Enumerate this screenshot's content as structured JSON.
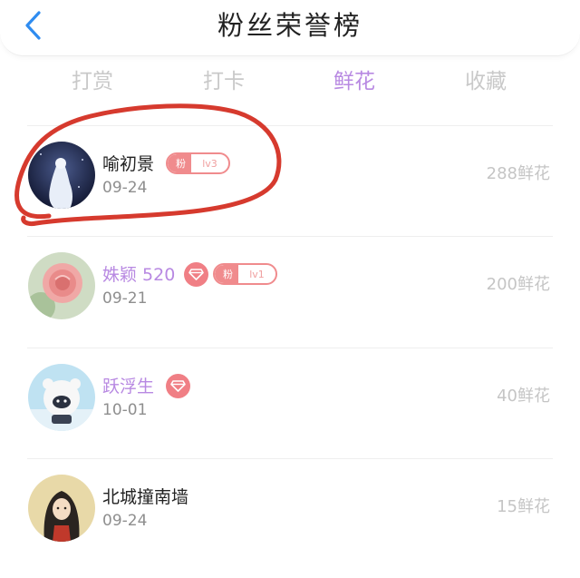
{
  "header": {
    "title": "粉丝荣誉榜"
  },
  "tabs": [
    {
      "label": "打赏",
      "active": false
    },
    {
      "label": "打卡",
      "active": false
    },
    {
      "label": "鲜花",
      "active": true
    },
    {
      "label": "收藏",
      "active": false
    }
  ],
  "fans": [
    {
      "name": "喻初景",
      "date": "09-24",
      "count": "288鲜花",
      "badge_label": "粉",
      "level": "lv3",
      "diamond": false,
      "name_color": "#222222"
    },
    {
      "name": "姝颖 520",
      "date": "09-21",
      "count": "200鲜花",
      "badge_label": "粉",
      "level": "lv1",
      "diamond": true,
      "name_color": "#b889e2"
    },
    {
      "name": "跃浮生",
      "date": "10-01",
      "count": "40鲜花",
      "diamond": true,
      "name_color": "#b889e2"
    },
    {
      "name": "北城撞南墙",
      "date": "09-24",
      "count": "15鲜花",
      "diamond": false,
      "name_color": "#222222"
    }
  ],
  "colors": {
    "accent": "#b889e2",
    "badge": "#f08b8d",
    "annotation": "#d63a2e"
  },
  "icons": {
    "back": "chevron-left-icon",
    "diamond": "diamond-icon"
  }
}
